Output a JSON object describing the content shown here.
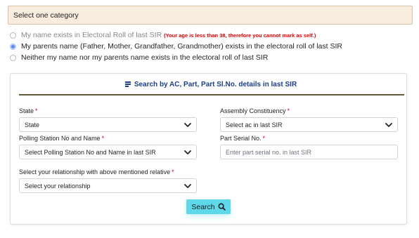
{
  "category": {
    "header": "Select one category"
  },
  "options": [
    {
      "label": "My name exists in Electoral Roll of last SIR",
      "note": "(Your age is less than 38, therefore you cannot mark as self.)",
      "state": "disabled"
    },
    {
      "label": "My parents name (Father, Mother, Grandfather, Grandmother) exists in the electoral roll of last SIR",
      "state": "selected"
    },
    {
      "label": "Neither my name nor my parents name exists in the electoral roll of last SIR",
      "state": "unselected"
    }
  ],
  "search_form": {
    "tab_title": "Search by AC, Part, Part Sl.No. details in last SIR",
    "state": {
      "label": "State",
      "value": "State"
    },
    "assembly": {
      "label": "Assembly Constituency",
      "value": "Select ac in last SIR"
    },
    "polling": {
      "label": "Polling Station No and Name",
      "value": "Select Polling Station No and Name in last SIR"
    },
    "serial": {
      "label": "Part Serial No.",
      "placeholder": "Enter part serial no. in last SIR"
    },
    "relationship": {
      "label": "Select your relationship with above mentioned relative",
      "value": "Select your relationship"
    },
    "required_mark": "*",
    "search_label": "Search"
  },
  "colors": {
    "accent_button": "#5fd8ea",
    "radio_selected": "#5b8def",
    "header_bg": "#f8ecdf",
    "required": "#d0021b"
  },
  "icons": {
    "tab": "list-icon",
    "dropdown": "chevron-down-icon",
    "search": "search-icon"
  }
}
